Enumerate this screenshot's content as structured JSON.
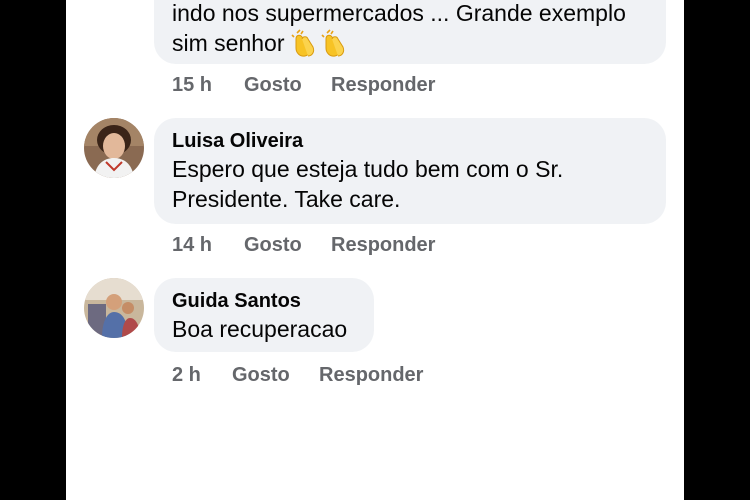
{
  "comments": [
    {
      "text_line1": "indo nos supermercados  ... Grande exemplo",
      "text_line2": "sim senhor",
      "time": "15 h",
      "like_label": "Gosto",
      "reply_label": "Responder",
      "emoji": "clapping-hands-icon"
    },
    {
      "author": "Luisa Oliveira",
      "text_line1": "Espero que esteja tudo bem com o Sr.",
      "text_line2": "Presidente. Take care.",
      "time": "14 h",
      "like_label": "Gosto",
      "reply_label": "Responder"
    },
    {
      "author": "Guida Santos",
      "text_line1": "Boa recuperacao",
      "time": "2 h",
      "like_label": "Gosto",
      "reply_label": "Responder"
    }
  ],
  "colors": {
    "bubble": "#f0f2f5",
    "text": "#050505",
    "secondary": "#65676b",
    "background": "#ffffff"
  }
}
